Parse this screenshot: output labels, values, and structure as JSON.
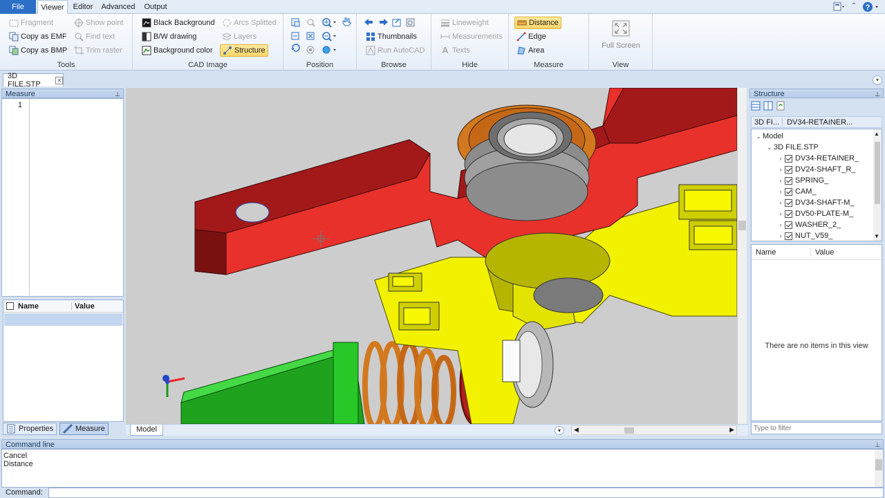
{
  "menu": {
    "file": "File",
    "tabs": [
      "Viewer",
      "Editor",
      "Advanced",
      "Output"
    ]
  },
  "ribbon": {
    "tools": {
      "label": "Tools",
      "fragment": "Fragment",
      "copy_emf": "Copy as EMF",
      "copy_bmp": "Copy as BMP",
      "show_point": "Show point",
      "find_text": "Find text",
      "trim_raster": "Trim raster"
    },
    "cad_image": {
      "label": "CAD Image",
      "black_background": "Black Background",
      "bw_drawing": "B/W drawing",
      "background_color": "Background color",
      "arcs_splitted": "Arcs Splitted",
      "layers": "Layers",
      "structure": "Structure"
    },
    "position": {
      "label": "Position"
    },
    "browse": {
      "label": "Browse",
      "thumbnails": "Thumbnails",
      "run_autocad": "Run AutoCAD"
    },
    "hide": {
      "label": "Hide",
      "lineweight": "Lineweight",
      "measurements": "Measurements",
      "texts": "Texts"
    },
    "measure": {
      "label": "Measure",
      "distance": "Distance",
      "edge": "Edge",
      "area": "Area"
    },
    "view": {
      "label": "View",
      "full_screen": "Full Screen"
    }
  },
  "document_tab": "3D FILE.STP",
  "left_panel": {
    "title": "Measure",
    "line_number": "1",
    "grid_headers": [
      "Name",
      "Value"
    ],
    "tabs": [
      "Properties",
      "Measure"
    ]
  },
  "viewport": {
    "model_tab": "Model"
  },
  "right_panel": {
    "title": "Structure",
    "breadcrumb": [
      "3D FI...",
      "DV34-RETAINER..."
    ],
    "tree_root": "Model",
    "tree_file": "3D FILE.STP",
    "tree_items": [
      "DV34-RETAINER_",
      "DV24-SHAFT_R_",
      "SPRING_",
      "CAM_",
      "DV34-SHAFT-M_",
      "DV50-PLATE-M_",
      "WASHER_2_",
      "NUT_V59_"
    ],
    "props_headers": [
      "Name",
      "Value"
    ],
    "empty_message": "There are no items in this view",
    "filter_placeholder": "Type to filter"
  },
  "command": {
    "title": "Command line",
    "lines": [
      "Cancel",
      "Distance"
    ],
    "prompt": "Command:"
  },
  "colors": {
    "accent": "#2b6fc6",
    "highlight": "#f8d56a",
    "part_red": "#e8312a",
    "part_dark_red": "#a3191a",
    "part_yellow": "#f2f200",
    "part_green": "#21c021",
    "part_orange": "#d2781e"
  }
}
